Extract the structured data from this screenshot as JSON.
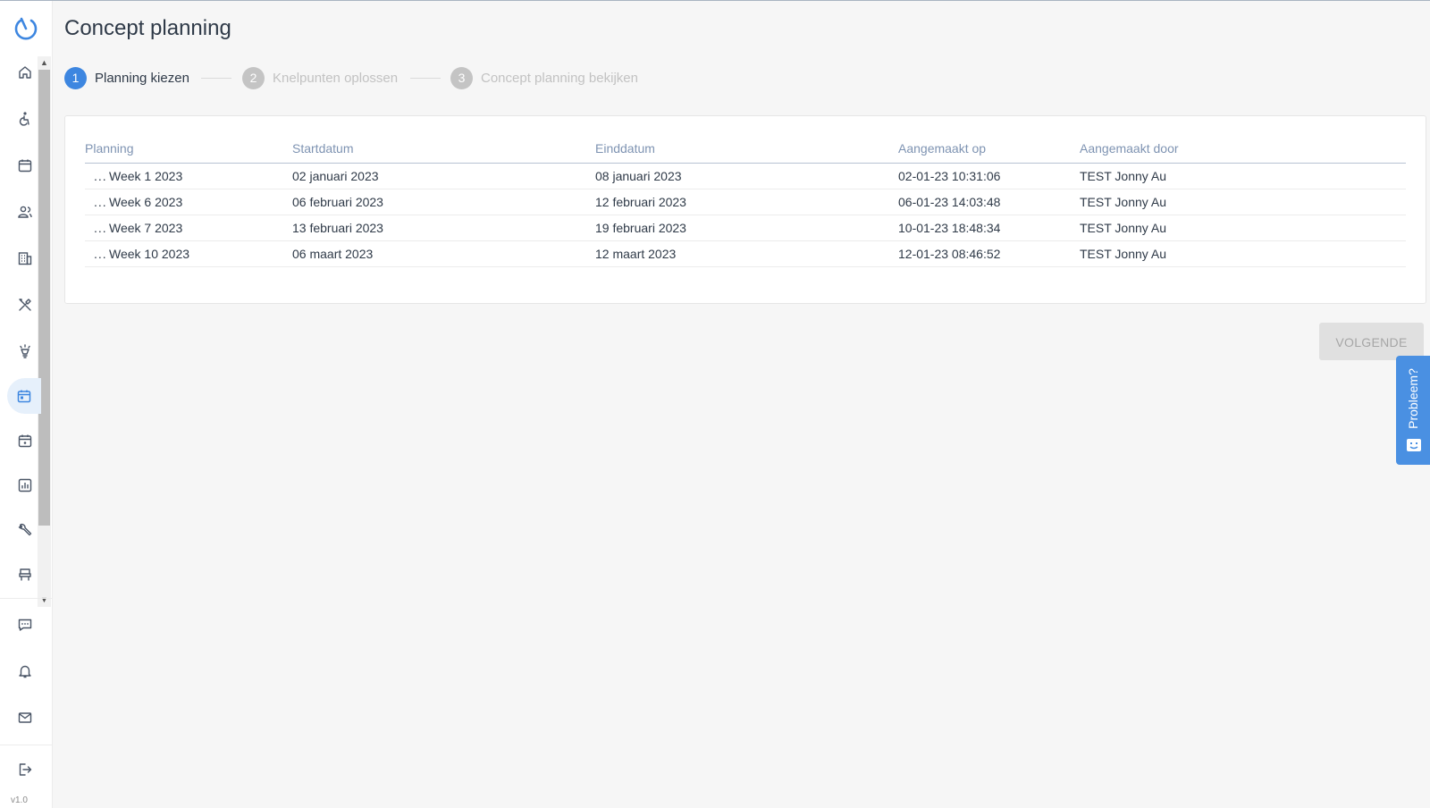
{
  "app": {
    "version": "v1.0"
  },
  "page": {
    "title": "Concept planning"
  },
  "stepper": {
    "steps": [
      {
        "num": "1",
        "label": "Planning kiezen",
        "state": "active"
      },
      {
        "num": "2",
        "label": "Knelpunten oplossen",
        "state": "inactive"
      },
      {
        "num": "3",
        "label": "Concept planning bekijken",
        "state": "inactive"
      }
    ]
  },
  "table": {
    "columns": [
      "Planning",
      "Startdatum",
      "Einddatum",
      "Aangemaakt op",
      "Aangemaakt door"
    ],
    "rows": [
      {
        "planning": "Week 1 2023",
        "start": "02 januari 2023",
        "end": "08 januari 2023",
        "created_on": "02-01-23 10:31:06",
        "created_by": "TEST Jonny Au"
      },
      {
        "planning": "Week 6 2023",
        "start": "06 februari 2023",
        "end": "12 februari 2023",
        "created_on": "06-01-23 14:03:48",
        "created_by": "TEST Jonny Au"
      },
      {
        "planning": "Week 7 2023",
        "start": "13 februari 2023",
        "end": "19 februari 2023",
        "created_on": "10-01-23 18:48:34",
        "created_by": "TEST Jonny Au"
      },
      {
        "planning": "Week 10 2023",
        "start": "06 maart 2023",
        "end": "12 maart 2023",
        "created_on": "12-01-23 08:46:52",
        "created_by": "TEST Jonny Au"
      }
    ],
    "row_menu_glyph": "..."
  },
  "actions": {
    "next_label": "VOLGENDE"
  },
  "feedback": {
    "label": "Probleem?"
  },
  "sidebar": {
    "items": [
      {
        "name": "home-icon",
        "active": false
      },
      {
        "name": "accessibility-icon",
        "active": false
      },
      {
        "name": "calendar-icon",
        "active": false
      },
      {
        "name": "people-icon",
        "active": false
      },
      {
        "name": "building-icon",
        "active": false
      },
      {
        "name": "tools-icon",
        "active": false
      },
      {
        "name": "lightbulb-icon",
        "active": false
      },
      {
        "name": "calendar-planning-icon",
        "active": true
      },
      {
        "name": "calendar-event-icon",
        "active": false
      },
      {
        "name": "report-chart-icon",
        "active": false
      },
      {
        "name": "wrench-icon",
        "active": false
      },
      {
        "name": "seat-icon",
        "active": false
      }
    ],
    "bottom": [
      "chat-icon",
      "bell-icon",
      "mail-icon"
    ],
    "logout": "logout-icon"
  },
  "colors": {
    "accent": "#3d86e0",
    "feedback_tab": "#4a90e2",
    "header_text": "#7e93b2",
    "background": "#f6f6f6"
  }
}
